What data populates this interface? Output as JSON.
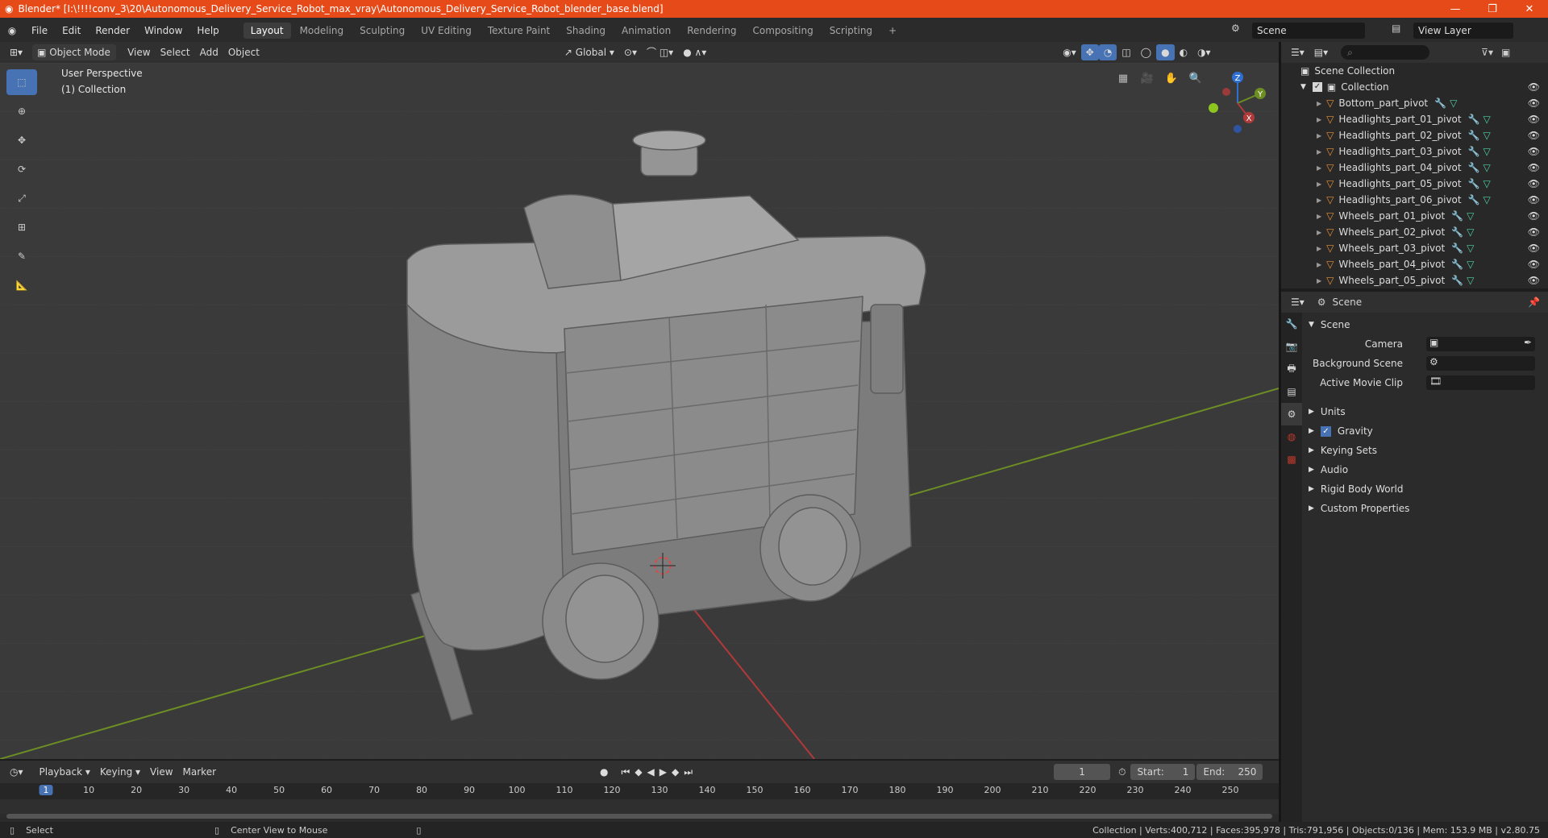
{
  "window": {
    "title": "Blender* [I:\\!!!!conv_3\\20\\Autonomous_Delivery_Service_Robot_max_vray\\Autonomous_Delivery_Service_Robot_blender_base.blend]",
    "minimize": "—",
    "maximize": "❐",
    "close": "✕"
  },
  "menu": {
    "items": [
      "File",
      "Edit",
      "Render",
      "Window",
      "Help"
    ]
  },
  "workspaces": [
    "Layout",
    "Modeling",
    "Sculpting",
    "UV Editing",
    "Texture Paint",
    "Shading",
    "Animation",
    "Rendering",
    "Compositing",
    "Scripting"
  ],
  "scene": {
    "label": "Scene",
    "view_layer": "View Layer"
  },
  "viewport_header": {
    "mode": "Object Mode",
    "view": "View",
    "select": "Select",
    "add": "Add",
    "object": "Object",
    "transform": "Global"
  },
  "viewport": {
    "perspective": "User Perspective",
    "collection": "(1) Collection"
  },
  "gizmo": {
    "x": "X",
    "y": "Y",
    "z": "Z"
  },
  "outliner": {
    "root": "Scene Collection",
    "collection": "Collection",
    "items": [
      "Bottom_part_pivot",
      "Headlights_part_01_pivot",
      "Headlights_part_02_pivot",
      "Headlights_part_03_pivot",
      "Headlights_part_04_pivot",
      "Headlights_part_05_pivot",
      "Headlights_part_06_pivot",
      "Wheels_part_01_pivot",
      "Wheels_part_02_pivot",
      "Wheels_part_03_pivot",
      "Wheels_part_04_pivot",
      "Wheels_part_05_pivot"
    ]
  },
  "properties": {
    "header": "Scene",
    "section": "Scene",
    "camera": "Camera",
    "background_scene": "Background Scene",
    "active_movie_clip": "Active Movie Clip",
    "panels": [
      "Units",
      "Gravity",
      "Keying Sets",
      "Audio",
      "Rigid Body World",
      "Custom Properties"
    ]
  },
  "timeline": {
    "playback": "Playback",
    "keying": "Keying",
    "view": "View",
    "marker": "Marker",
    "current_frame": "1",
    "start_label": "Start:",
    "start": "1",
    "end_label": "End:",
    "end": "250",
    "ticks": [
      "1",
      "10",
      "20",
      "30",
      "40",
      "50",
      "60",
      "70",
      "80",
      "90",
      "100",
      "110",
      "120",
      "130",
      "140",
      "150",
      "160",
      "170",
      "180",
      "190",
      "200",
      "210",
      "220",
      "230",
      "240",
      "250"
    ]
  },
  "status": {
    "select": "Select",
    "center": "Center View to Mouse",
    "stats": "Collection | Verts:400,712 | Faces:395,978 | Tris:791,956 | Objects:0/136 | Mem: 153.9 MB | v2.80.75"
  },
  "colors": {
    "title_bar": "#e64a19",
    "active_tool": "#4772b3",
    "x_axis": "#b03a3a",
    "y_axis": "#6c8e23",
    "z_axis": "#2f6fd1"
  }
}
